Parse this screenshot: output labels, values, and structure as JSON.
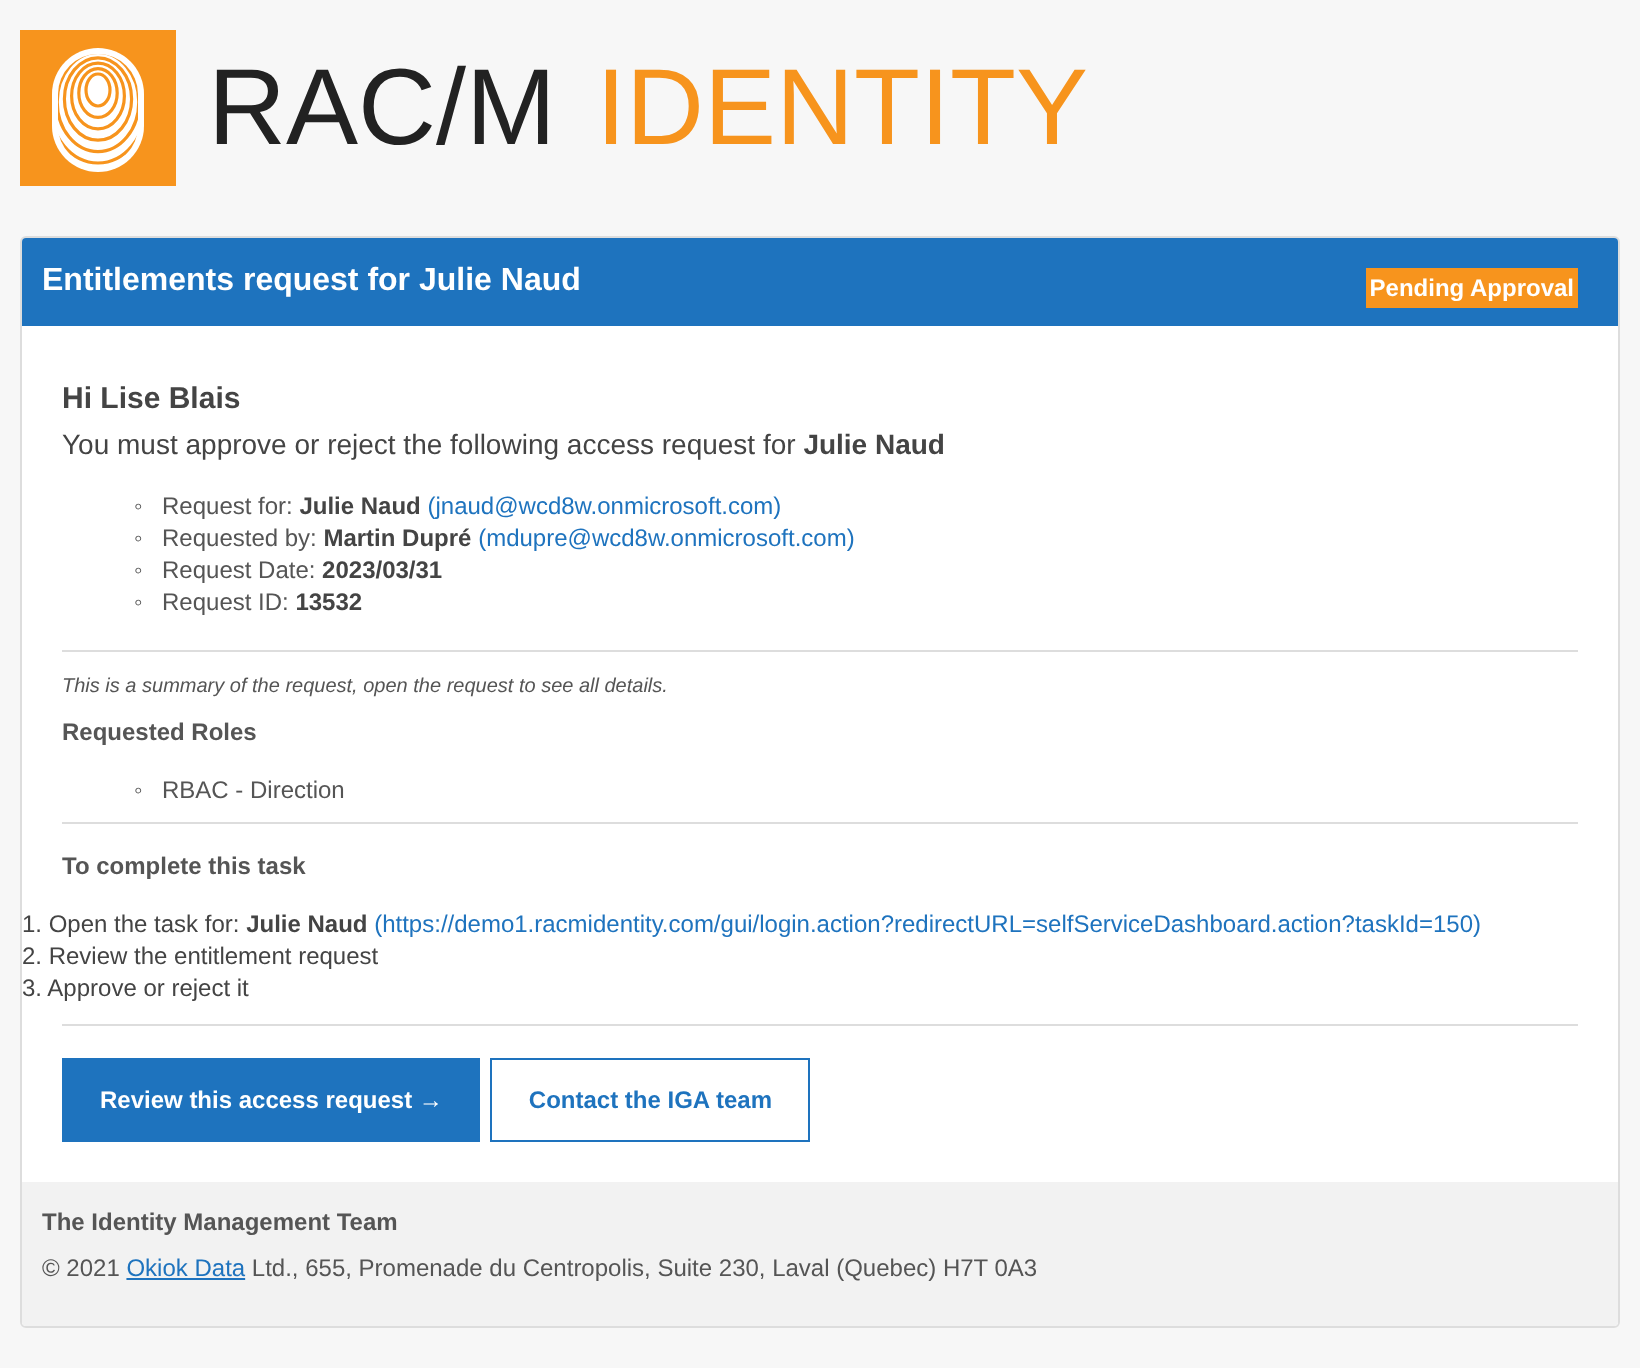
{
  "logo": {
    "text_dark": "RAC/M",
    "text_accent": "IDENTITY"
  },
  "header": {
    "title": "Entitlements request for Julie Naud",
    "status": "Pending Approval"
  },
  "greeting": "Hi Lise Blais",
  "intro": "You must approve or reject the following access request for **Julie Naud**",
  "details": [
    {
      "marker": "◦",
      "label": "Request for:",
      "value": "Julie Naud",
      "link": "(jnaud@wcd8w.onmicrosoft.com)"
    },
    {
      "marker": "◦",
      "label": "Requested by:",
      "value": "Martin Dupré",
      "link": "(mdupre@wcd8w.onmicrosoft.com)"
    },
    {
      "marker": "◦",
      "label": "Request Date:",
      "value": "2023/03/31"
    },
    {
      "marker": "◦",
      "label": "Request ID:",
      "value": "13532"
    }
  ],
  "summary_note": "This is a summary of the request, open the request to see all details.",
  "roles_heading": "Requested Roles",
  "roles": [
    {
      "marker": "◦",
      "label": "RBAC - Direction"
    }
  ],
  "task_heading": "To complete this task",
  "steps": [
    {
      "number": "1.",
      "label": "Open the task for:",
      "value": "Julie Naud",
      "link": "(https://demo1.racmidentity.com/gui/login.action?redirectURL=selfServiceDashboard.action?taskId=150)"
    },
    {
      "number": "2.",
      "label": "Review the entitlement request"
    },
    {
      "number": "3.",
      "label": "Approve or reject it"
    }
  ],
  "buttons": [
    {
      "label": "Review this access request →",
      "kind": "primary"
    },
    {
      "label": "Contact the IGA team",
      "kind": "secondary"
    }
  ],
  "footer": {
    "team": "The Identity Management Team",
    "copyright_prefix": "© 2021",
    "company_link": "Okiok Data",
    "copyright_suffix": "Ltd., 655, Promenade du Centropolis, Suite 230, Laval (Quebec) H7T 0A3"
  }
}
